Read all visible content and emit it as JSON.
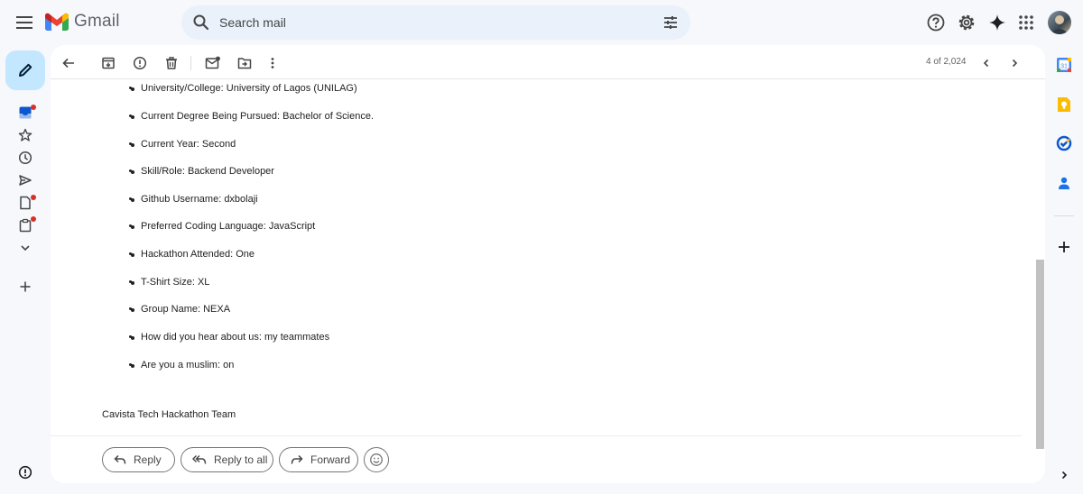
{
  "app": {
    "name": "Gmail"
  },
  "search": {
    "placeholder": "Search mail"
  },
  "pager": {
    "text": "4 of 2,024"
  },
  "email": {
    "fields": [
      "University/College: University of Lagos (UNILAG)",
      "Current Degree Being Pursued: Bachelor of Science.",
      "Current Year: Second",
      "Skill/Role: Backend Developer",
      "Github Username: dxbolaji",
      "Preferred Coding Language: JavaScript",
      "Hackathon Attended: One",
      "T-Shirt Size: XL",
      "Group Name: NEXA",
      "How did you hear about us: my teammates",
      "Are you a muslim: on"
    ],
    "signature": "Cavista Tech Hackathon Team"
  },
  "actions": {
    "reply": "Reply",
    "reply_all": "Reply to all",
    "forward": "Forward"
  },
  "colors": {
    "background": "#f6f8fc",
    "compose": "#c2e7ff",
    "search": "#eaf1fb",
    "notification_dot": "#d93025"
  },
  "icons": {
    "header": [
      "menu-icon",
      "gmail-logo",
      "search-icon",
      "tune-icon",
      "help-icon",
      "settings-icon",
      "gemini-icon",
      "apps-icon"
    ],
    "rail": [
      "compose-icon",
      "inbox-icon",
      "star-icon",
      "clock-icon",
      "send-icon",
      "draft-icon",
      "clipboard-icon",
      "chevron-down-icon",
      "plus-icon",
      "info-icon"
    ],
    "toolbar": [
      "back-arrow-icon",
      "archive-icon",
      "report-spam-icon",
      "delete-icon",
      "mark-unread-icon",
      "move-to-icon",
      "more-vert-icon",
      "chevron-left-icon",
      "chevron-right-icon"
    ],
    "side": [
      "calendar-icon",
      "keep-icon",
      "tasks-icon",
      "contacts-icon",
      "add-icon",
      "expand-icon"
    ]
  }
}
